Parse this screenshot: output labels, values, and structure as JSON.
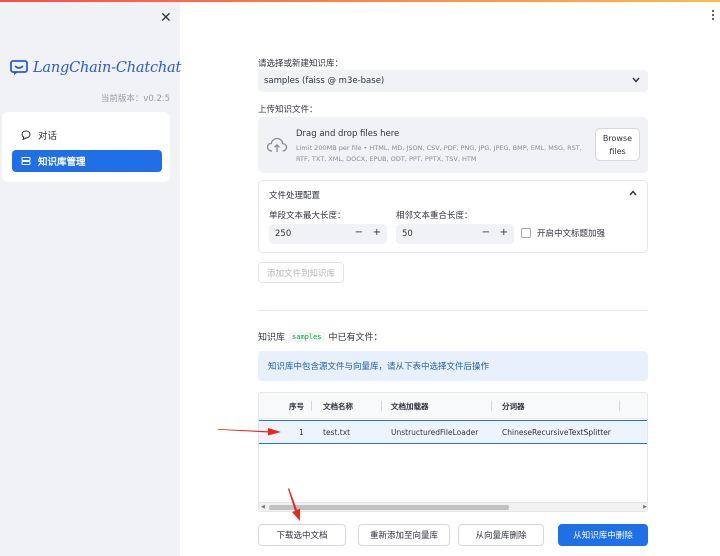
{
  "sidebar": {
    "close_glyph": "✕",
    "logo_text": "LangChain-Chatchat",
    "version": "当前版本：v0.2.5",
    "nav": [
      {
        "label": "对话",
        "icon": "chat-bubble-icon",
        "active": false
      },
      {
        "label": "知识库管理",
        "icon": "database-icon",
        "active": true
      }
    ]
  },
  "main": {
    "select_label": "请选择或新建知识库：",
    "select_value": "samples (faiss @ m3e-base)",
    "upload_label": "上传知识文件：",
    "uploader": {
      "drag_text": "Drag and drop files here",
      "limit_text": "Limit 200MB per file • HTML, MD, JSON, CSV, PDF, PNG, JPG, JPEG, BMP, EML, MSG, RST, RTF, TXT, XML, DOCX, EPUB, ODT, PPT, PPTX, TSV, HTM",
      "browse_line1": "Browse",
      "browse_line2": "files"
    },
    "settings": {
      "title": "文件处理配置",
      "chunk_size_label": "单段文本最大长度：",
      "chunk_size_value": "250",
      "overlap_label": "相邻文本重合长度：",
      "overlap_value": "50",
      "zh_title_label": "开启中文标题加强",
      "minus": "−",
      "plus": "+"
    },
    "add_button": "添加文件到知识库",
    "kb_title_pre": "知识库",
    "kb_name": "samples",
    "kb_title_post": "中已有文件：",
    "info": "知识库中包含源文件与向量库，请从下表中选择文件后操作",
    "table": {
      "headers": [
        "序号",
        "文档名称",
        "文档加载器",
        "分词器"
      ],
      "rows": [
        {
          "no": "1",
          "name": "test.txt",
          "loader": "UnstructuredFileLoader",
          "splitter": "ChineseRecursiveTextSplitter"
        }
      ]
    },
    "buttons": {
      "download": "下载选中文档",
      "readd": "重新添加至向量库",
      "delete_vs": "从向量库删除",
      "delete_kb": "从知识库中删除"
    }
  },
  "colors": {
    "accent": "#1f6fe6",
    "annotation_arrow": "#e8261c"
  }
}
